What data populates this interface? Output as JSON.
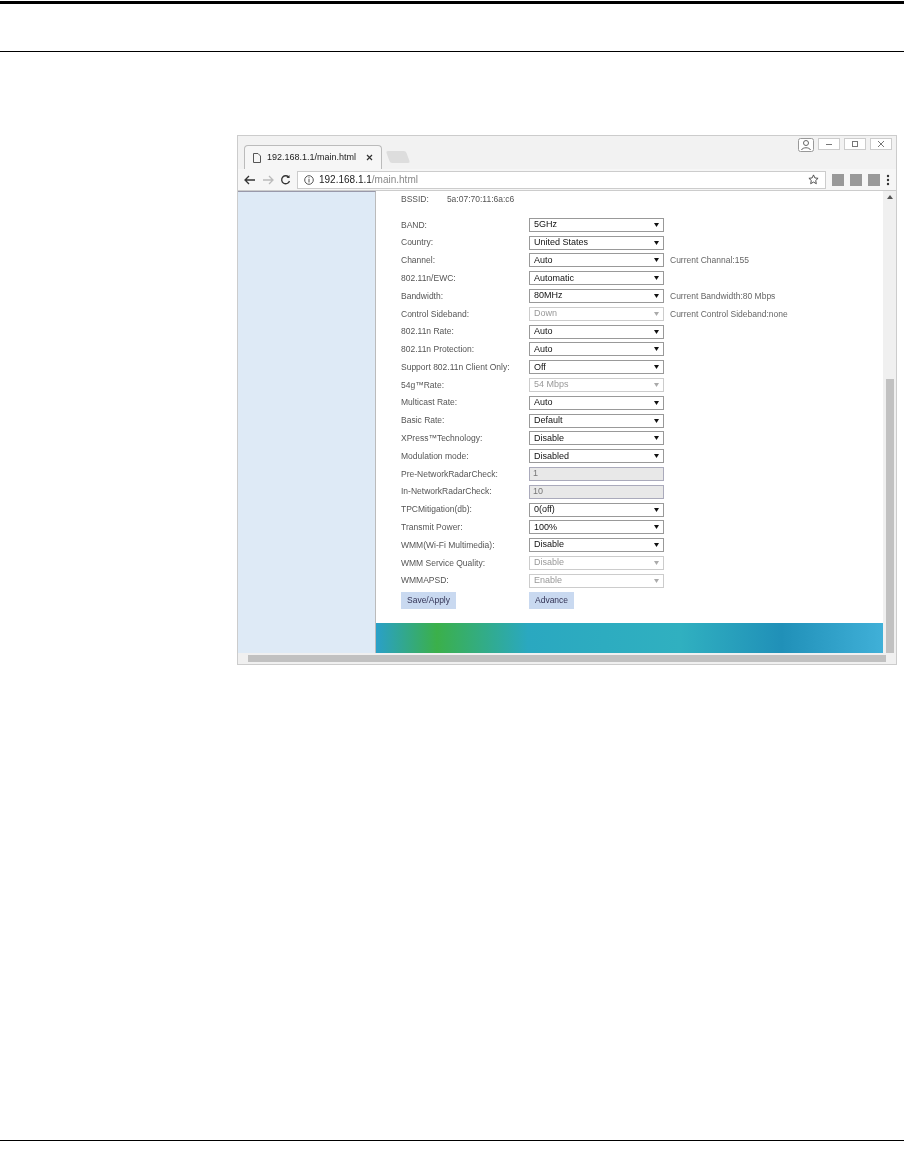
{
  "browser": {
    "tab_title": "192.168.1.1/main.html",
    "url_host": "192.168.1.1",
    "url_path": "/main.html"
  },
  "bssid": {
    "label": "BSSID:",
    "value": "5a:07:70:11:6a:c6"
  },
  "fields": [
    {
      "label": "BAND:",
      "kind": "select",
      "value": "5GHz",
      "disabled": false
    },
    {
      "label": "Country:",
      "kind": "select",
      "value": "United States",
      "disabled": false
    },
    {
      "label": "Channel:",
      "kind": "select",
      "value": "Auto",
      "disabled": false,
      "note": "Current Channal:155"
    },
    {
      "label": "802.11n/EWC:",
      "kind": "select",
      "value": "Automatic",
      "disabled": false
    },
    {
      "label": "Bandwidth:",
      "kind": "select",
      "value": "80MHz",
      "disabled": false,
      "note": "Current Bandwidth:80 Mbps"
    },
    {
      "label": "Control Sideband:",
      "kind": "select",
      "value": "Down",
      "disabled": true,
      "note": "Current Control Sideband:none"
    },
    {
      "label": "802.11n Rate:",
      "kind": "select",
      "value": "Auto",
      "disabled": false
    },
    {
      "label": "802.11n Protection:",
      "kind": "select",
      "value": "Auto",
      "disabled": false
    },
    {
      "label": "Support 802.11n Client Only:",
      "kind": "select",
      "value": "Off",
      "disabled": false
    },
    {
      "label": "54g™Rate:",
      "kind": "select",
      "value": "54 Mbps",
      "disabled": true
    },
    {
      "label": "Multicast Rate:",
      "kind": "select",
      "value": "Auto",
      "disabled": false
    },
    {
      "label": "Basic Rate:",
      "kind": "select",
      "value": "Default",
      "disabled": false
    },
    {
      "label": "XPress™Technology:",
      "kind": "select",
      "value": "Disable",
      "disabled": false
    },
    {
      "label": "Modulation mode:",
      "kind": "select",
      "value": "Disabled",
      "disabled": false
    },
    {
      "label": "Pre-NetworkRadarCheck:",
      "kind": "input",
      "value": "1",
      "disabled": true
    },
    {
      "label": "In-NetworkRadarCheck:",
      "kind": "input",
      "value": "10",
      "disabled": true
    },
    {
      "label": "TPCMitigation(db):",
      "kind": "select",
      "value": "0(off)",
      "disabled": false
    },
    {
      "label": "Transmit Power:",
      "kind": "select",
      "value": "100%",
      "disabled": false
    },
    {
      "label": "WMM(Wi-Fi Multimedia):",
      "kind": "select",
      "value": "Disable",
      "disabled": false
    },
    {
      "label": "WMM Service Quality:",
      "kind": "select",
      "value": "Disable",
      "disabled": true
    },
    {
      "label": "WMMAPSD:",
      "kind": "select",
      "value": "Enable",
      "disabled": true
    }
  ],
  "buttons": [
    "Save/Apply",
    "Advance"
  ]
}
